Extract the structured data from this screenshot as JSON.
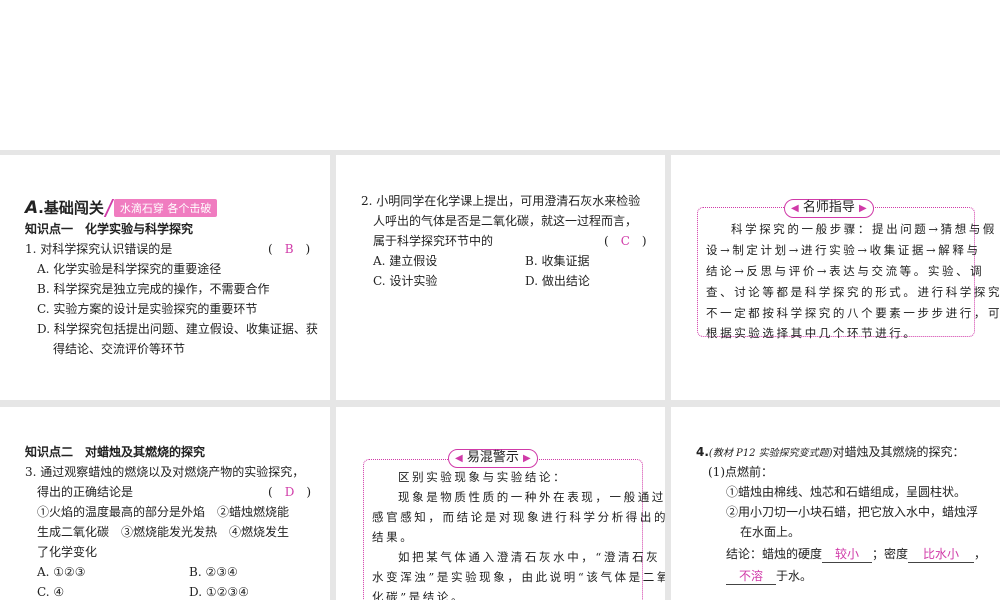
{
  "section": {
    "letter": "A",
    "title": ".基础闯关",
    "tag": "水滴石穿 各个击破"
  },
  "kp1": "知识点一　化学实验与科学探究",
  "q1": {
    "stem": "1. 对科学探究认识错误的是",
    "answer": "B",
    "options": [
      "A. 化学实验是科学探究的重要途径",
      "B. 科学探究是独立完成的操作，不需要合作",
      "C. 实验方案的设计是实验探究的重要环节",
      "D. 科学探究包括提出问题、建立假设、收集证据、获",
      "得结论、交流评价等环节"
    ]
  },
  "q2": {
    "lines": [
      "2. 小明同学在化学课上提出，可用澄清石灰水来检验",
      "人呼出的气体是否是二氧化碳，就这一过程而言，",
      "属于科学探究环节中的"
    ],
    "answer": "C",
    "options": [
      "A. 建立假设",
      "B. 收集证据",
      "C. 设计实验",
      "D. 做出结论"
    ]
  },
  "tip1": {
    "title": "名师指导",
    "lines": [
      "科学探究的一般步骤：提出问题→猜想与假",
      "设→制定计划→进行实验→收集证据→解释与",
      "结论→反思与评价→表达与交流等。实验、调",
      "查、讨论等都是科学探究的形式。进行科学探究",
      "不一定都按科学探究的八个要素一步步进行，可",
      "根据实验选择其中几个环节进行。"
    ]
  },
  "kp2": "知识点二　对蜡烛及其燃烧的探究",
  "q3": {
    "lines": [
      "3. 通过观察蜡烛的燃烧以及对燃烧产物的实验探究，",
      "得出的正确结论是",
      "①火焰的温度最高的部分是外焰　②蜡烛燃烧能",
      "生成二氧化碳　③燃烧能发光发热　④燃烧发生",
      "了化学变化"
    ],
    "answer": "D",
    "options": [
      "A. ①②③",
      "B. ②③④",
      "C. ④",
      "D. ①②③④"
    ]
  },
  "tip2": {
    "title": "易混警示",
    "lines": [
      "区别实验现象与实验结论：",
      "现象是物质性质的一种外在表现，一般通过",
      "感官感知，而结论是对现象进行科学分析得出的",
      "结果。",
      "如把某气体通入澄清石灰水中，“澄清石灰",
      "水变浑浊”是实验现象，由此说明“该气体是二氧",
      "化碳”是结论。"
    ]
  },
  "q4": {
    "num": "4.",
    "source": "(教材 P12 实验探究变式题)",
    "stem": "对蜡烛及其燃烧的探究：",
    "part1": "(1)点燃前：",
    "l1": "①蜡烛由棉线、烛芯和石蜡组成，呈圆柱状。",
    "l2": "②用小刀切一小块石蜡，把它放入水中，蜡烛浮",
    "l3": "在水面上。",
    "c_pre": "结论：蜡烛的硬度",
    "f1": "较小",
    "c_mid": "；密度",
    "f2": "比水小",
    "c_end": "，",
    "f3": "不溶",
    "c_tail": "于水。"
  }
}
